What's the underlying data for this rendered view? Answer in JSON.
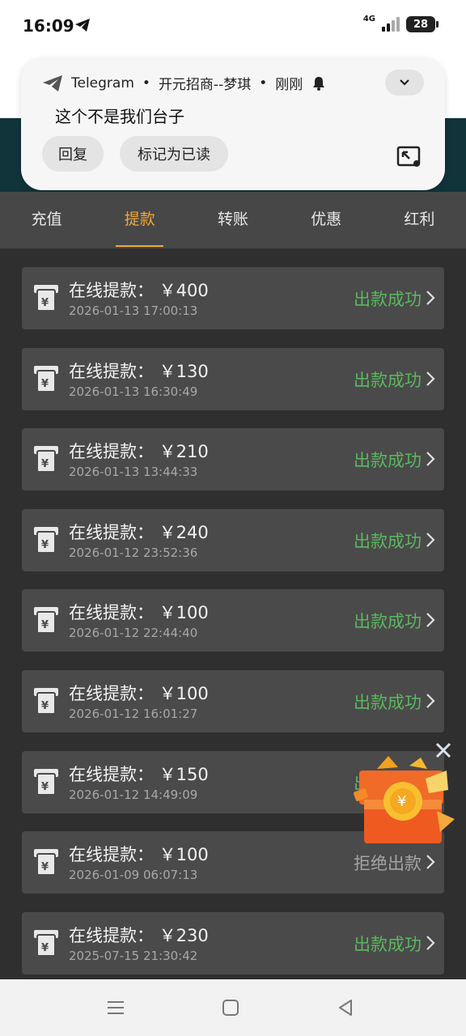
{
  "status_bar": {
    "time": "16:09",
    "network": "4G",
    "battery": "28"
  },
  "notification": {
    "app": "Telegram",
    "separator": "•",
    "sender": "开元招商--梦琪",
    "when": "刚刚",
    "message": "这个不是我们台子",
    "actions": {
      "reply": "回复",
      "mark_read": "标记为已读"
    }
  },
  "tabs": [
    {
      "label": "充值",
      "active": false
    },
    {
      "label": "提款",
      "active": true
    },
    {
      "label": "转账",
      "active": false
    },
    {
      "label": "优惠",
      "active": false
    },
    {
      "label": "红利",
      "active": false
    }
  ],
  "records": [
    {
      "title": "在线提款： ￥400",
      "time": "2026-01-13 17:00:13",
      "status": "出款成功",
      "state": "ok"
    },
    {
      "title": "在线提款： ￥130",
      "time": "2026-01-13 16:30:49",
      "status": "出款成功",
      "state": "ok"
    },
    {
      "title": "在线提款： ￥210",
      "time": "2026-01-13 13:44:33",
      "status": "出款成功",
      "state": "ok"
    },
    {
      "title": "在线提款： ￥240",
      "time": "2026-01-12 23:52:36",
      "status": "出款成功",
      "state": "ok"
    },
    {
      "title": "在线提款： ￥100",
      "time": "2026-01-12 22:44:40",
      "status": "出款成功",
      "state": "ok"
    },
    {
      "title": "在线提款： ￥100",
      "time": "2026-01-12 16:01:27",
      "status": "出款成功",
      "state": "ok"
    },
    {
      "title": "在线提款： ￥150",
      "time": "2026-01-12 14:49:09",
      "status": "出款成功",
      "state": "ok"
    },
    {
      "title": "在线提款： ￥100",
      "time": "2026-01-09 06:07:13",
      "status": "拒绝出款",
      "state": "fail"
    },
    {
      "title": "在线提款： ￥230",
      "time": "2025-07-15 21:30:42",
      "status": "出款成功",
      "state": "ok"
    }
  ],
  "colors": {
    "accent": "#f0a83a",
    "success": "#5bb85f",
    "rejected": "#a4a4a4",
    "card": "#4a4a4a",
    "page": "#2f2f2f"
  }
}
